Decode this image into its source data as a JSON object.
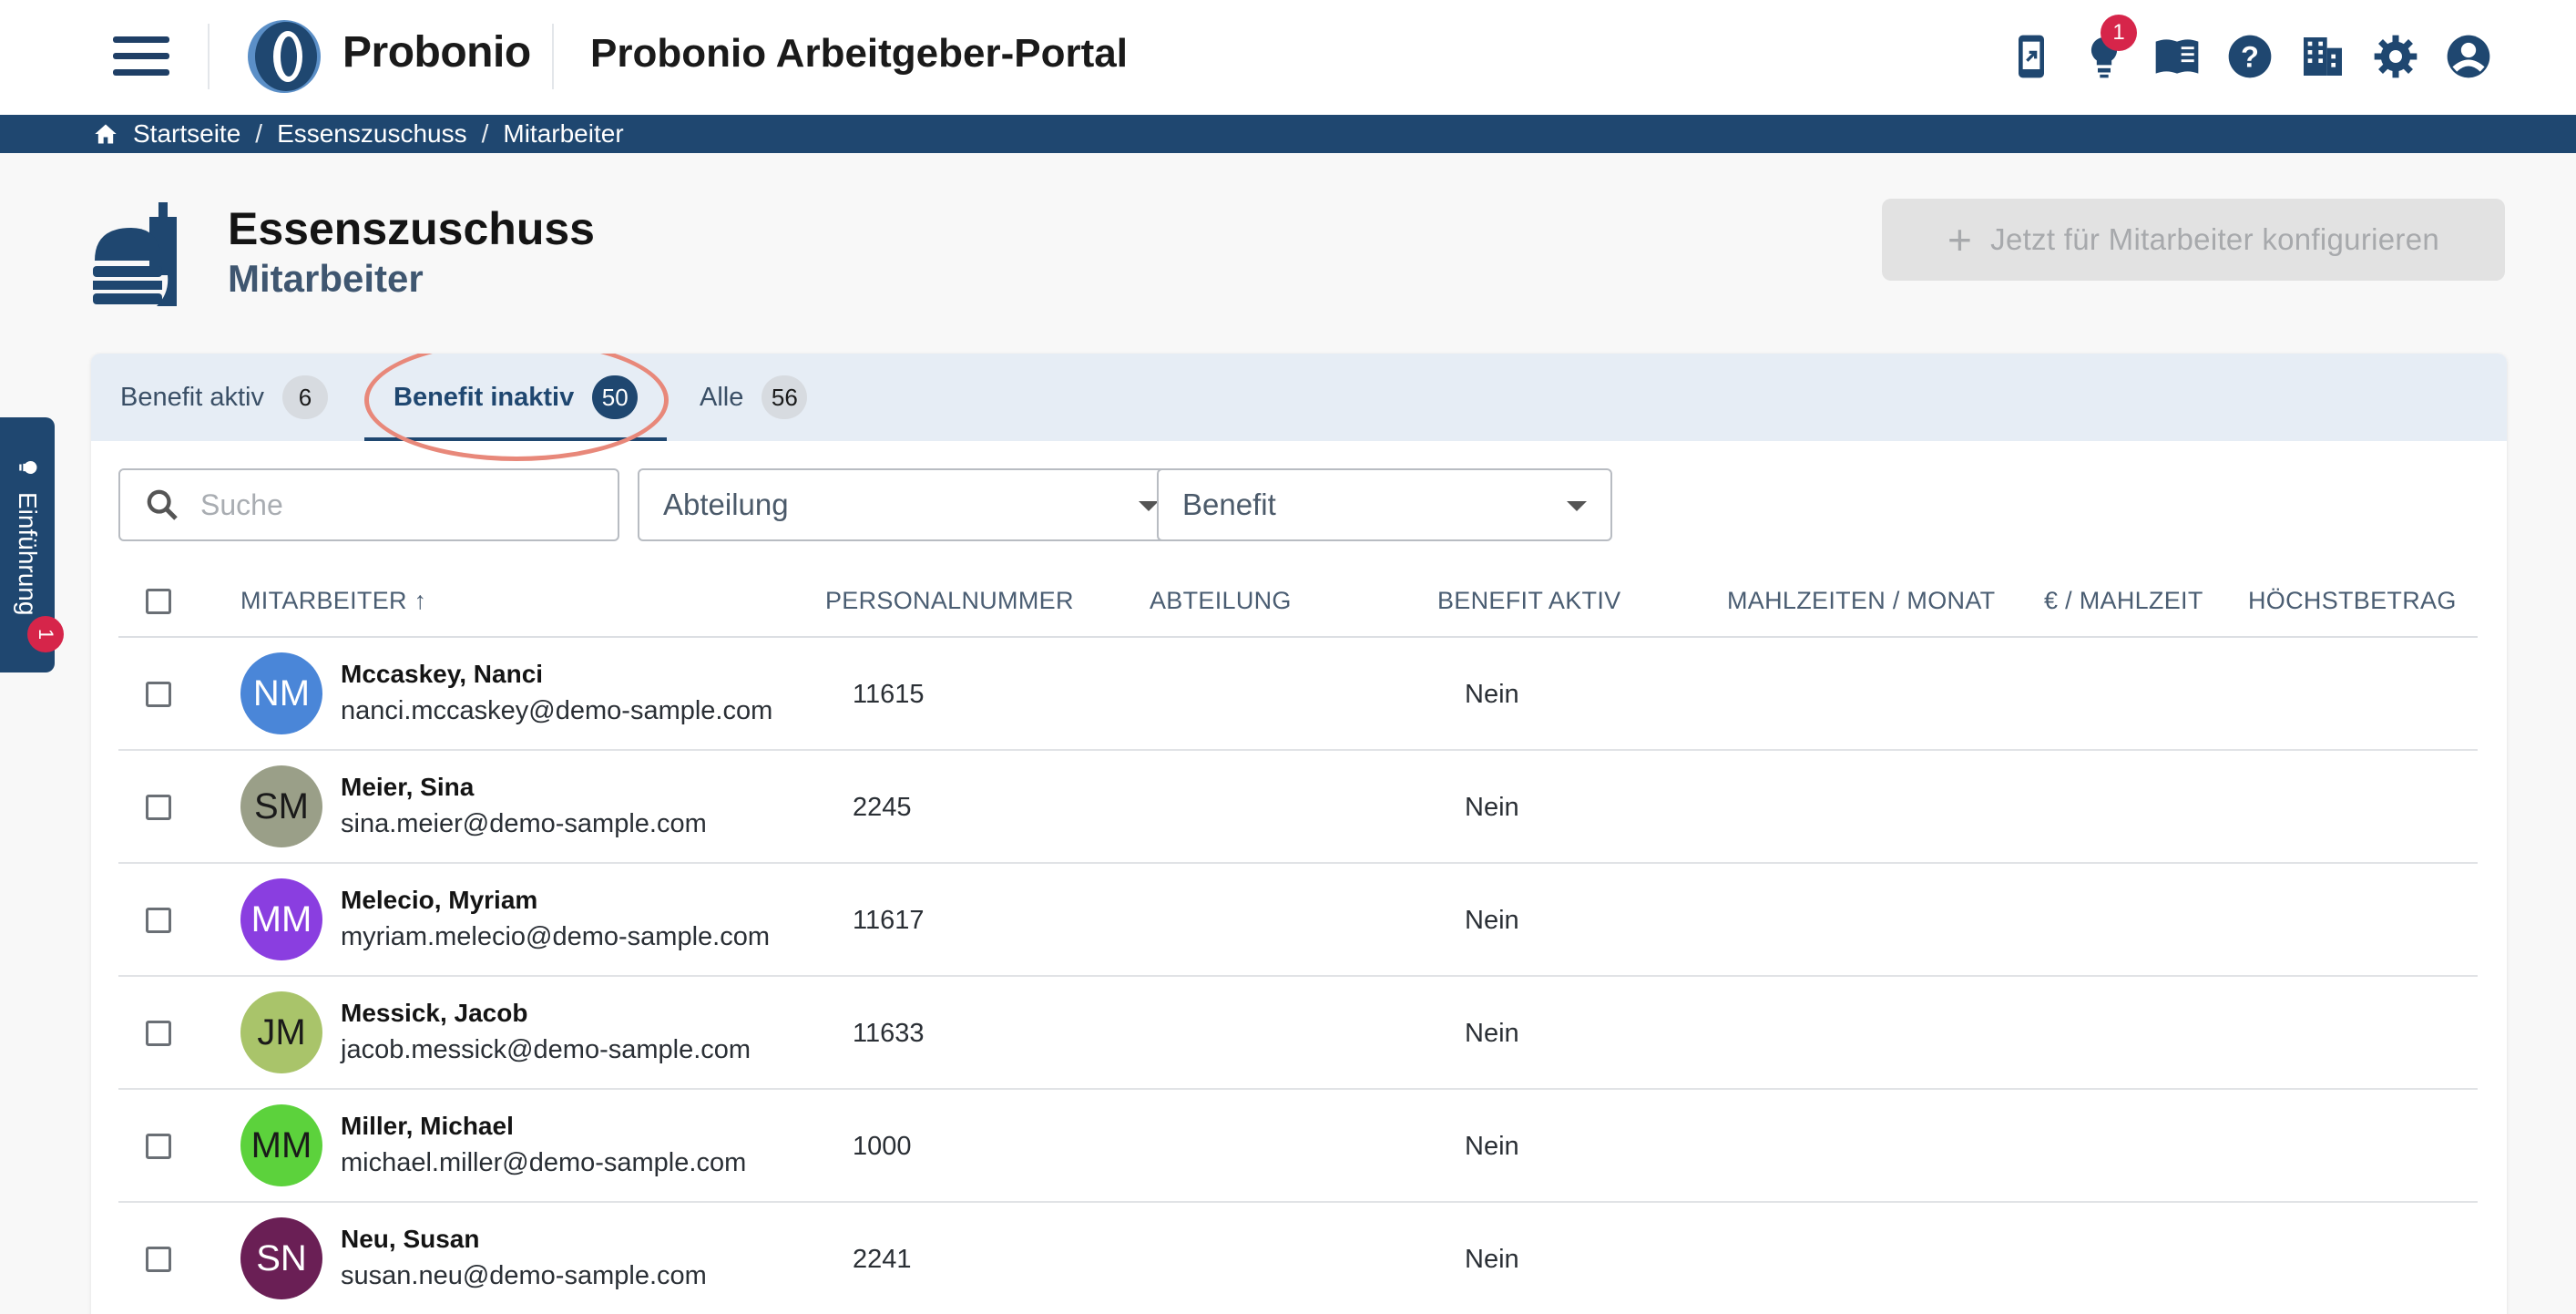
{
  "app": {
    "brand": "Probonio",
    "portal_title": "Probonio Arbeitgeber-Portal",
    "notification_count": "1"
  },
  "icons": [
    "menu-icon",
    "mobile-app-icon",
    "lightbulb-icon",
    "book-icon",
    "help-icon",
    "company-icon",
    "settings-icon",
    "account-icon"
  ],
  "breadcrumb": {
    "items": [
      "Startseite",
      "Essenszuschuss",
      "Mitarbeiter"
    ],
    "separator": "/"
  },
  "page": {
    "title": "Essenszuschuss",
    "subtitle": "Mitarbeiter",
    "config_button": "Jetzt für Mitarbeiter konfigurieren"
  },
  "intro": {
    "label": "Einführung",
    "badge": "1"
  },
  "tabs": [
    {
      "label": "Benefit aktiv",
      "count": "6"
    },
    {
      "label": "Benefit inaktiv",
      "count": "50"
    },
    {
      "label": "Alle",
      "count": "56"
    }
  ],
  "filters": {
    "search_placeholder": "Suche",
    "department": "Abteilung",
    "benefit": "Benefit"
  },
  "table": {
    "columns": [
      "MITARBEITER",
      "PERSONALNUMMER",
      "ABTEILUNG",
      "BENEFIT AKTIV",
      "MAHLZEITEN / MONAT",
      "€ / MAHLZEIT",
      "HÖCHSTBETRAG"
    ],
    "sort_indicator": "↑",
    "rows": [
      {
        "initials": "NM",
        "name": "Mccaskey, Nanci",
        "email": "nanci.mccaskey@demo-sample.com",
        "personal_nr": "11615",
        "department": "",
        "benefit_active": "Nein",
        "avatar_color": "#4a86d8",
        "text_color": "#ffffff"
      },
      {
        "initials": "SM",
        "name": "Meier, Sina",
        "email": "sina.meier@demo-sample.com",
        "personal_nr": "2245",
        "department": "",
        "benefit_active": "Nein",
        "avatar_color": "#9a9f88",
        "text_color": "#1a1a1a"
      },
      {
        "initials": "MM",
        "name": "Melecio, Myriam",
        "email": "myriam.melecio@demo-sample.com",
        "personal_nr": "11617",
        "department": "",
        "benefit_active": "Nein",
        "avatar_color": "#8a3ee0",
        "text_color": "#ffffff"
      },
      {
        "initials": "JM",
        "name": "Messick, Jacob",
        "email": "jacob.messick@demo-sample.com",
        "personal_nr": "11633",
        "department": "",
        "benefit_active": "Nein",
        "avatar_color": "#a9c46a",
        "text_color": "#1a1a1a"
      },
      {
        "initials": "MM",
        "name": "Miller, Michael",
        "email": "michael.miller@demo-sample.com",
        "personal_nr": "1000",
        "department": "",
        "benefit_active": "Nein",
        "avatar_color": "#5cd23c",
        "text_color": "#1a1a1a"
      },
      {
        "initials": "SN",
        "name": "Neu, Susan",
        "email": "susan.neu@demo-sample.com",
        "personal_nr": "2241",
        "department": "",
        "benefit_active": "Nein",
        "avatar_color": "#6a1f55",
        "text_color": "#ffffff"
      }
    ]
  },
  "colors": {
    "primary": "#1f4770",
    "badge": "#d6254a",
    "highlight": "#e8887a"
  }
}
